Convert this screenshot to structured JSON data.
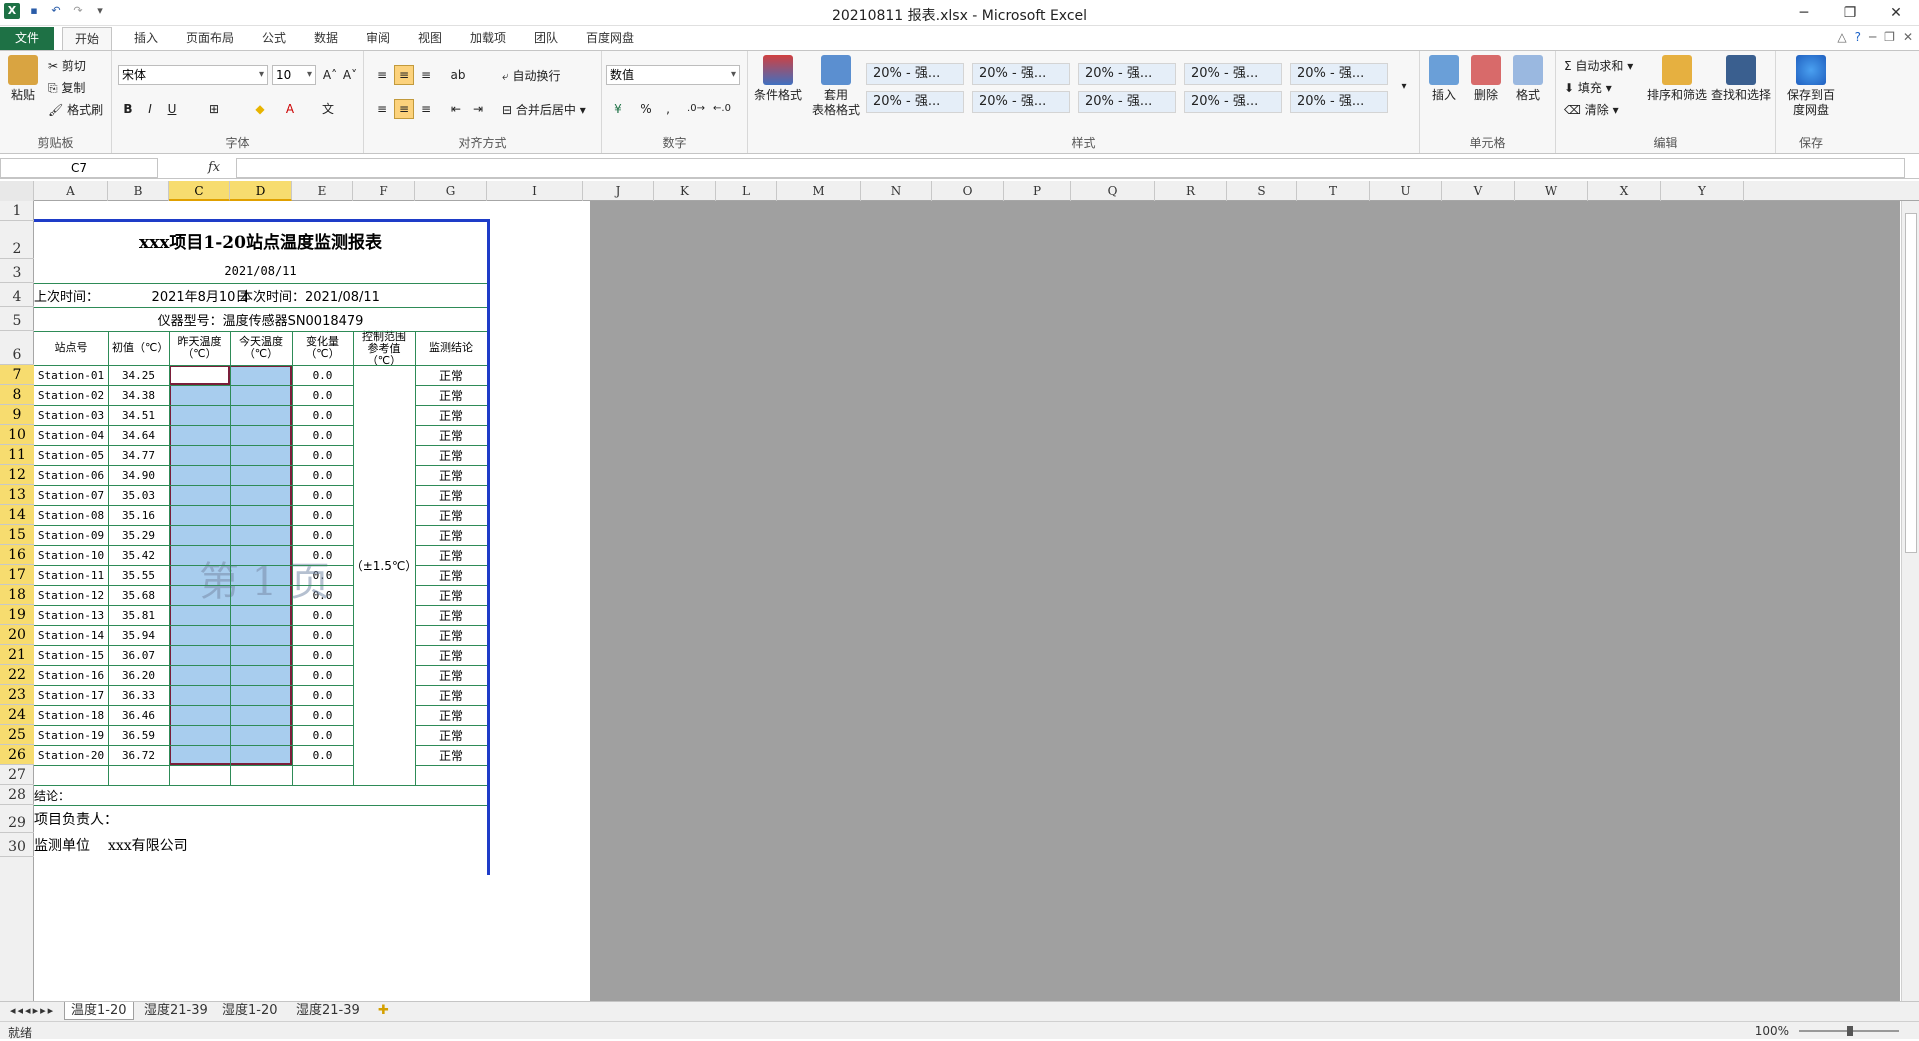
{
  "window": {
    "title": "20210811 报表.xlsx - Microsoft Excel"
  },
  "tabs": [
    "文件",
    "开始",
    "插入",
    "页面布局",
    "公式",
    "数据",
    "审阅",
    "视图",
    "加载项",
    "团队",
    "百度网盘"
  ],
  "ribbon": {
    "clipboard": {
      "label": "剪贴板",
      "paste": "粘贴",
      "cut": "剪切",
      "copy": "复制",
      "format_painter": "格式刷"
    },
    "font": {
      "label": "字体",
      "family": "宋体",
      "size": "10",
      "bold": "B",
      "italic": "I",
      "underline": "U"
    },
    "alignment": {
      "label": "对齐方式",
      "wrap": "自动换行",
      "merge": "合并后居中"
    },
    "number": {
      "label": "数字",
      "format": "数值",
      "percent": "%",
      "comma": ","
    },
    "styles": {
      "label": "样式",
      "conditional": "条件格式",
      "table_fmt1": "套用",
      "table_fmt2": "表格格式",
      "boxes": [
        "20% - 强...",
        "20% - 强...",
        "20% - 强...",
        "20% - 强...",
        "20% - 强...",
        "20% - 强...",
        "20% - 强...",
        "20% - 强...",
        "20% - 强...",
        "20% - 强..."
      ]
    },
    "cells": {
      "label": "单元格",
      "insert": "插入",
      "delete": "删除",
      "format": "格式"
    },
    "editing": {
      "label": "编辑",
      "autosum": "自动求和",
      "fill": "填充",
      "clear": "清除",
      "sort": "排序和筛选",
      "find": "查找和选择"
    },
    "save": {
      "label": "保存",
      "baidu1": "保存到百",
      "baidu2": "度网盘"
    }
  },
  "formula_bar": {
    "name_box": "C7",
    "fx": "fx",
    "value": ""
  },
  "columns": [
    "A",
    "B",
    "C",
    "D",
    "E",
    "F",
    "G",
    "I",
    "J",
    "K",
    "L",
    "M",
    "N",
    "O",
    "P",
    "Q",
    "R",
    "S",
    "T",
    "U",
    "V",
    "W",
    "X",
    "Y"
  ],
  "rows": [
    "1",
    "2",
    "3",
    "4",
    "5",
    "6",
    "7",
    "8",
    "9",
    "10",
    "11",
    "12",
    "13",
    "14",
    "15",
    "16",
    "17",
    "18",
    "19",
    "20",
    "21",
    "22",
    "23",
    "24",
    "25",
    "26",
    "27",
    "28",
    "29",
    "30"
  ],
  "sheet": {
    "title": "xxx项目1-20站点温度监测报表",
    "date": "2021/08/11",
    "last_time_label": "上次时间：",
    "last_time_value": "2021年8月10日",
    "this_time": "本次时间：2021/08/11",
    "instrument": "仪器型号：温度传感器SN0018479",
    "headers": [
      "站点号",
      "初值（℃）",
      "昨天温度（℃）",
      "今天温度（℃）",
      "变化量（℃）",
      "控制范围参考值（℃）",
      "监测结论"
    ],
    "range_value": "（±1.5℃）",
    "stations": [
      "Station-01",
      "Station-02",
      "Station-03",
      "Station-04",
      "Station-05",
      "Station-06",
      "Station-07",
      "Station-08",
      "Station-09",
      "Station-10",
      "Station-11",
      "Station-12",
      "Station-13",
      "Station-14",
      "Station-15",
      "Station-16",
      "Station-17",
      "Station-18",
      "Station-19",
      "Station-20"
    ],
    "initial": [
      "34.25",
      "34.38",
      "34.51",
      "34.64",
      "34.77",
      "34.90",
      "35.03",
      "35.16",
      "35.29",
      "35.42",
      "35.55",
      "35.68",
      "35.81",
      "35.94",
      "36.07",
      "36.20",
      "36.33",
      "36.46",
      "36.59",
      "36.72"
    ],
    "change": "0.0",
    "conclusion": "正常",
    "watermark": "第 1 页",
    "conclusion_label": "结论：",
    "leader": "项目负责人：",
    "unit_label": "监测单位",
    "unit_value": "xxx有限公司"
  },
  "sheet_tabs": [
    "温度1-20",
    "湿度21-39",
    "湿度1-20",
    "湿度21-39"
  ],
  "status": {
    "ready": "就绪",
    "zoom": "100%"
  }
}
